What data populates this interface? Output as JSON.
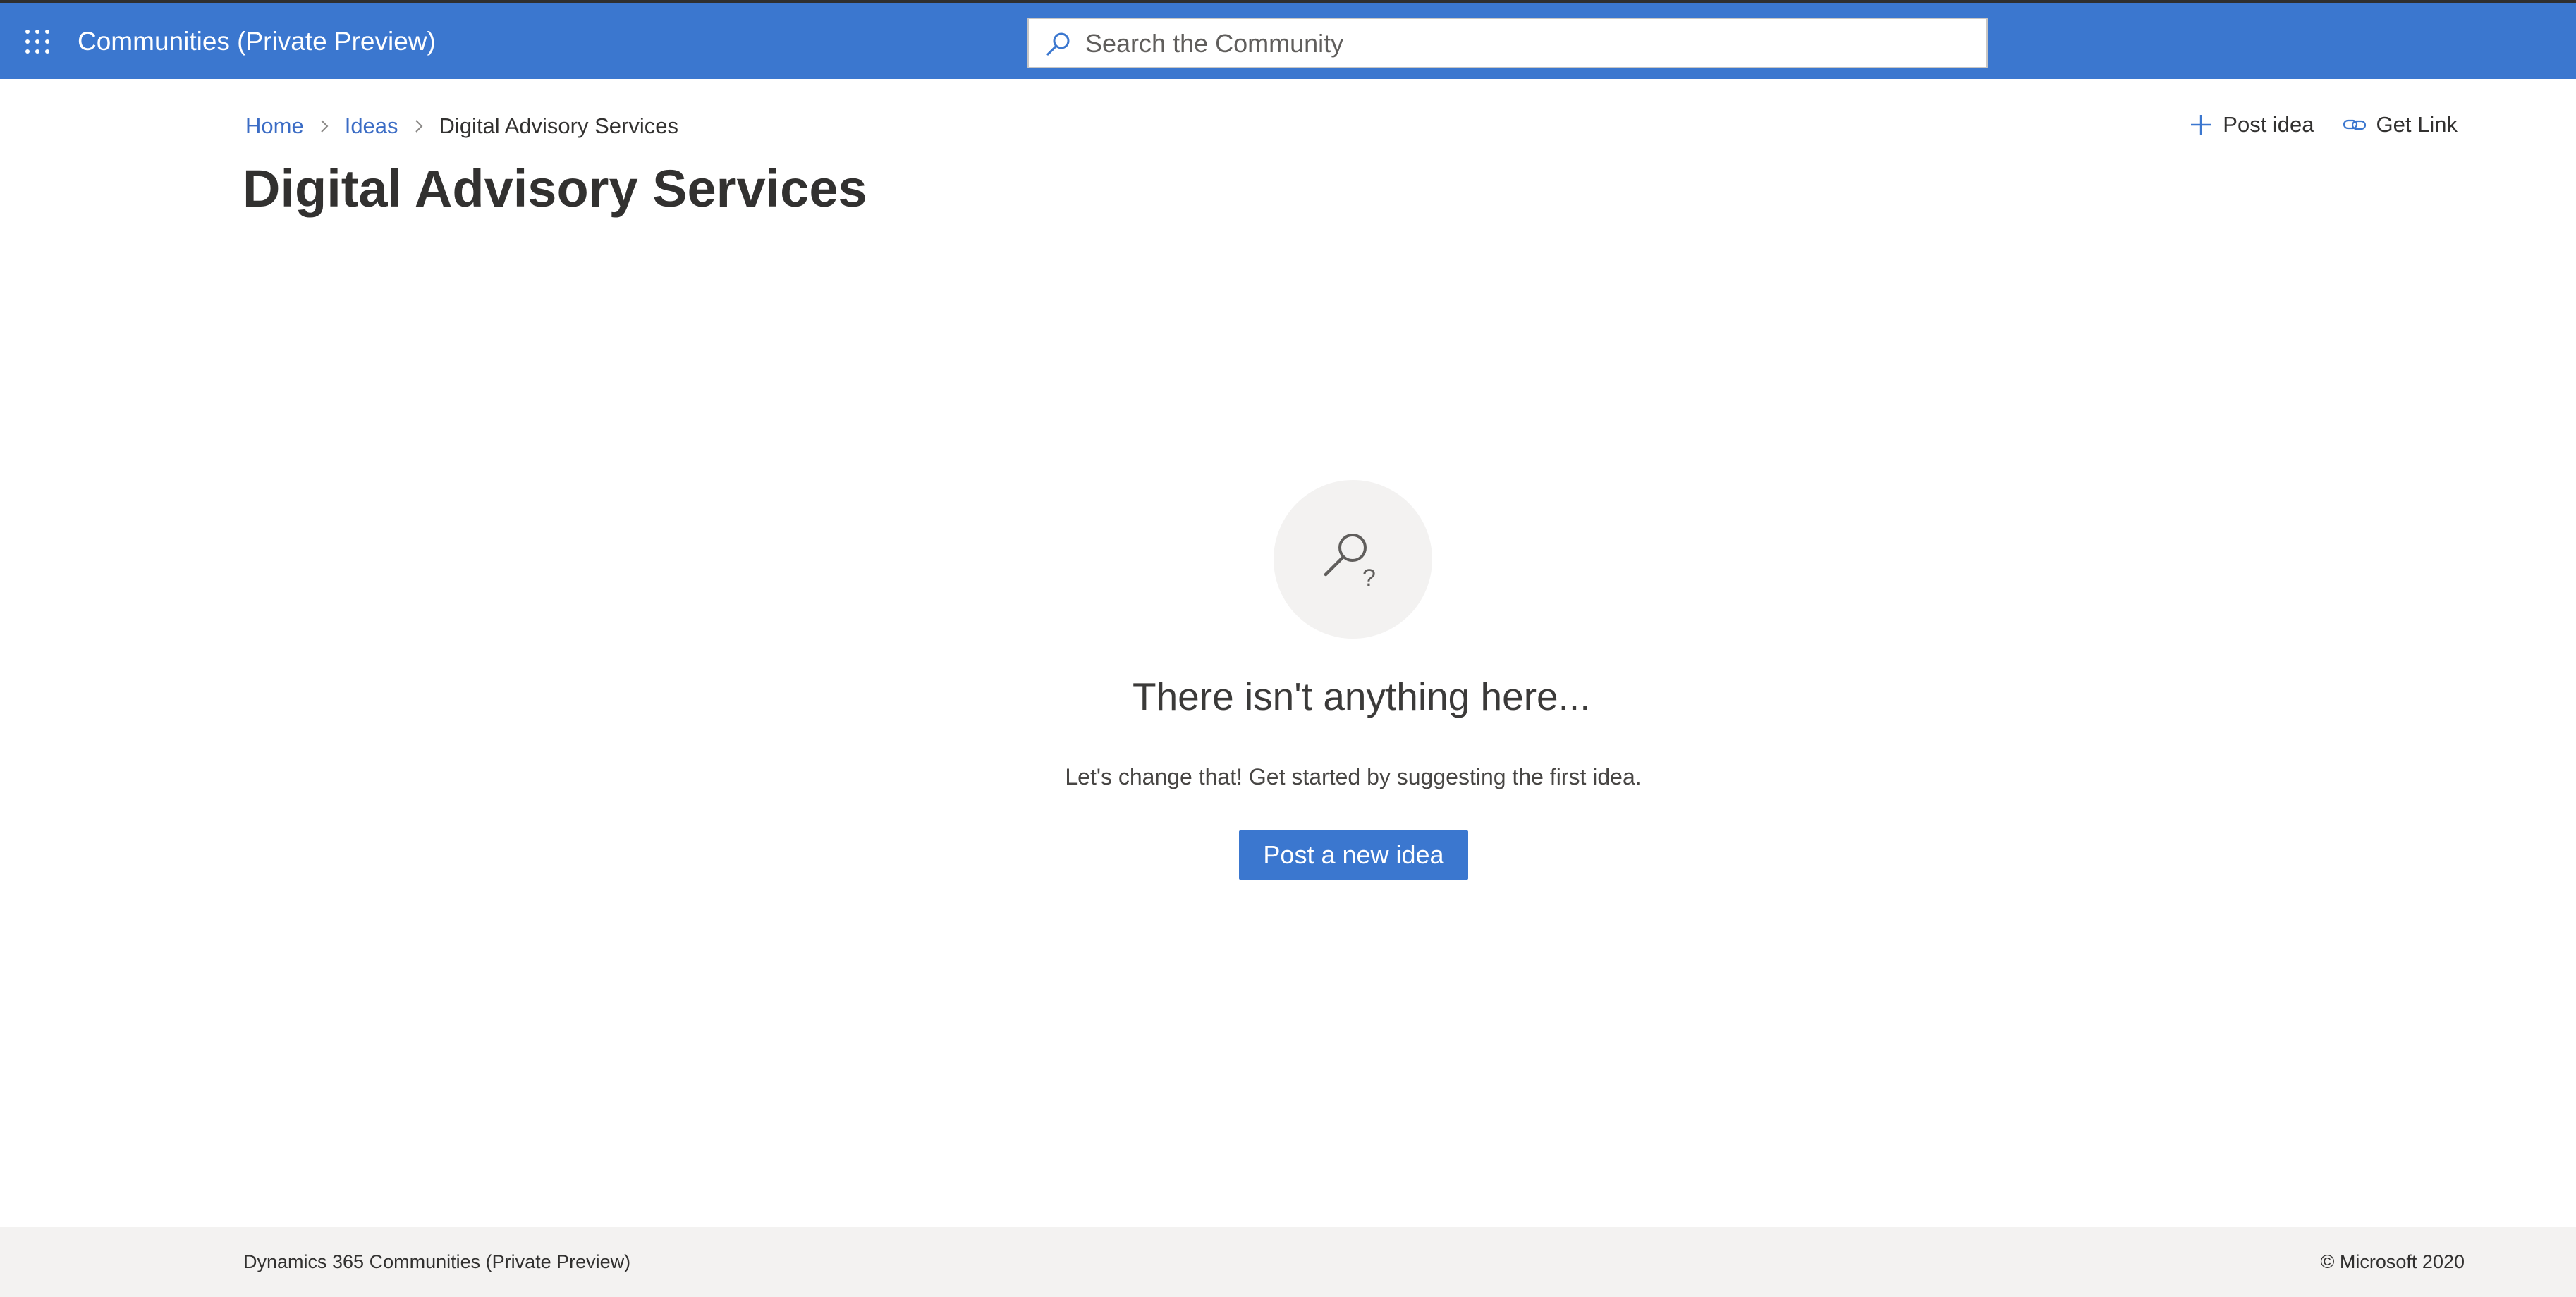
{
  "header": {
    "app_title": "Communities (Private Preview)",
    "search_placeholder": "Search the Community",
    "brand_color": "#3b77cf"
  },
  "breadcrumb": {
    "items": [
      "Home",
      "Ideas",
      "Digital Advisory Services"
    ]
  },
  "actions": {
    "post_idea": "Post idea",
    "get_link": "Get Link"
  },
  "page": {
    "title": "Digital Advisory Services"
  },
  "empty_state": {
    "icon": "search-question-icon",
    "heading": "There isn't anything here...",
    "message": "Let's change that! Get started by suggesting the first idea.",
    "button_label": "Post a new idea"
  },
  "footer": {
    "left_text": "Dynamics 365 Communities (Private Preview)",
    "right_text": "© Microsoft 2020"
  }
}
